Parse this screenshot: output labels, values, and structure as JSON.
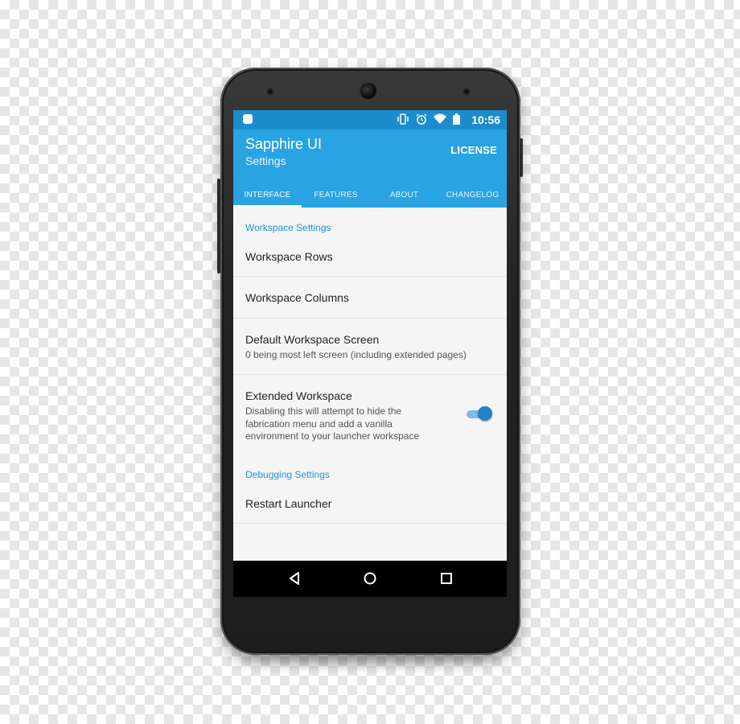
{
  "status_bar": {
    "time": "10:56",
    "icons": [
      "notification-app-icon",
      "vibrate-icon",
      "alarm-icon",
      "wifi-icon",
      "battery-icon"
    ]
  },
  "app_bar": {
    "title": "Sapphire UI",
    "subtitle": "Settings",
    "action_label": "LICENSE",
    "color": "#2aa3e3"
  },
  "tabs": [
    {
      "label": "INTERFACE",
      "active": true
    },
    {
      "label": "FEATURES",
      "active": false
    },
    {
      "label": "ABOUT",
      "active": false
    },
    {
      "label": "CHANGELOG",
      "active": false
    }
  ],
  "sections": {
    "workspace_header": "Workspace Settings",
    "debugging_header": "Debugging Settings"
  },
  "items": {
    "workspace_rows": {
      "title": "Workspace Rows"
    },
    "workspace_columns": {
      "title": "Workspace Columns"
    },
    "default_screen": {
      "title": "Default Workspace Screen",
      "summary": "0 being most left screen (including extended pages)"
    },
    "extended_workspace": {
      "title": "Extended Workspace",
      "summary_line1": "Disabling this will attempt to hide the",
      "summary_line2": "fabrication menu and add a vanilla",
      "summary_line3": "environment to your launcher workspace",
      "toggle_on": true
    },
    "restart_launcher": {
      "title": "Restart Launcher"
    }
  },
  "navigation": [
    "back-icon",
    "home-icon",
    "recents-icon"
  ],
  "colors": {
    "accent": "#1f94d2",
    "status_bar": "#1d8ccc",
    "toggle": "#1f83c6"
  }
}
